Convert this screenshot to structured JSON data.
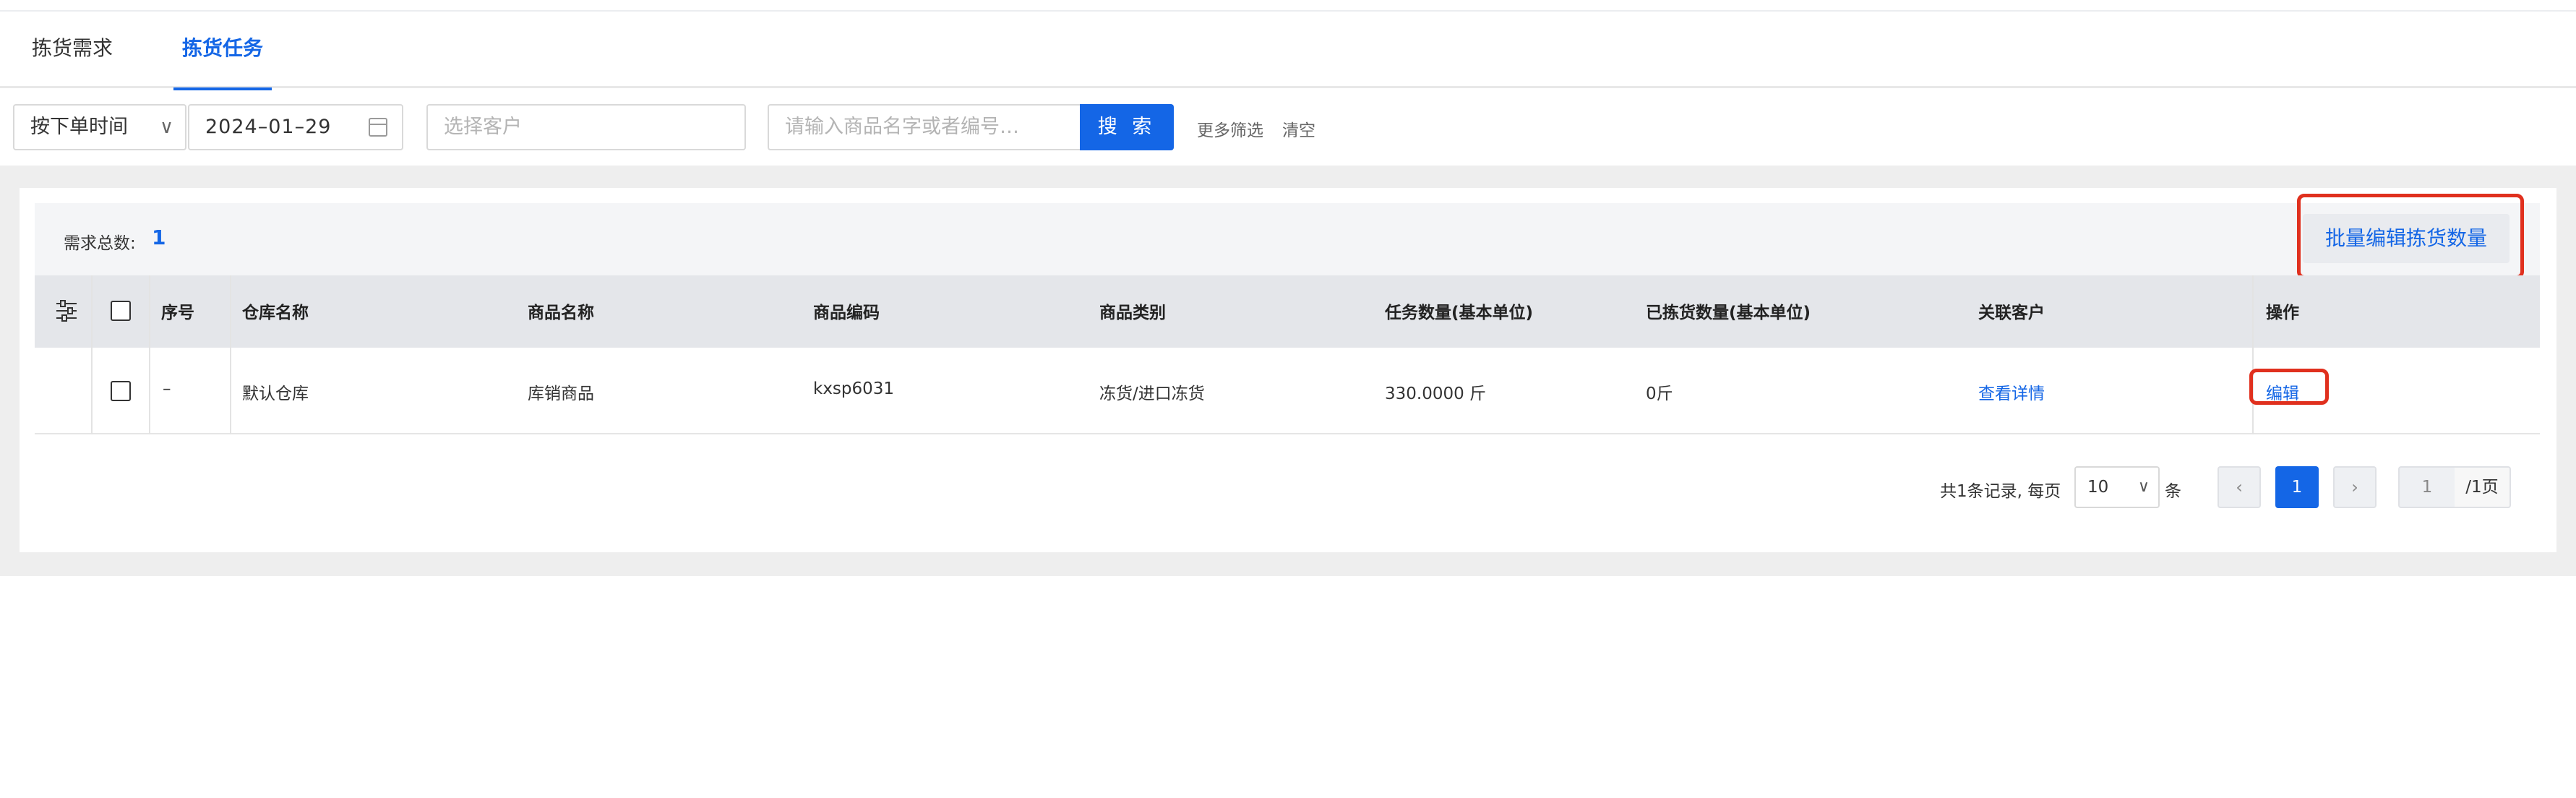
{
  "tabs": [
    {
      "label": "拣货需求",
      "active": false
    },
    {
      "label": "拣货任务",
      "active": true
    }
  ],
  "filters": {
    "time_type": "按下单时间",
    "date": "2024–01–29",
    "customer_placeholder": "选择客户",
    "search_placeholder": "请输入商品名字或者编号…",
    "search_button": "搜 索",
    "more_filters": "更多筛选",
    "clear": "清空"
  },
  "summary": {
    "label": "需求总数:",
    "value": "1",
    "batch_button": "批量编辑拣货数量"
  },
  "table": {
    "headers": [
      "序号",
      "仓库名称",
      "商品名称",
      "商品编码",
      "商品类别",
      "任务数量(基本单位)",
      "已拣货数量(基本单位)",
      "关联客户",
      "操作"
    ],
    "rows": [
      {
        "index": "–",
        "warehouse": "默认仓库",
        "product_name": "库销商品",
        "product_code": "kxsp6031",
        "category": "冻货/进口冻货",
        "task_qty": "330.0000 斤",
        "picked_qty": "0斤",
        "customer_link": "查看详情",
        "action": "编辑"
      }
    ]
  },
  "pagination": {
    "total_text": "共1条记录, 每页",
    "page_size": "10",
    "unit": "条",
    "prev": "‹",
    "current_page": "1",
    "next": "›",
    "jump_value": "1",
    "total_pages": "/1页"
  },
  "colors": {
    "accent": "#1466e6",
    "highlight": "#e0301e",
    "header_bg": "#e4e6ea",
    "backdrop": "#eeeeee"
  }
}
